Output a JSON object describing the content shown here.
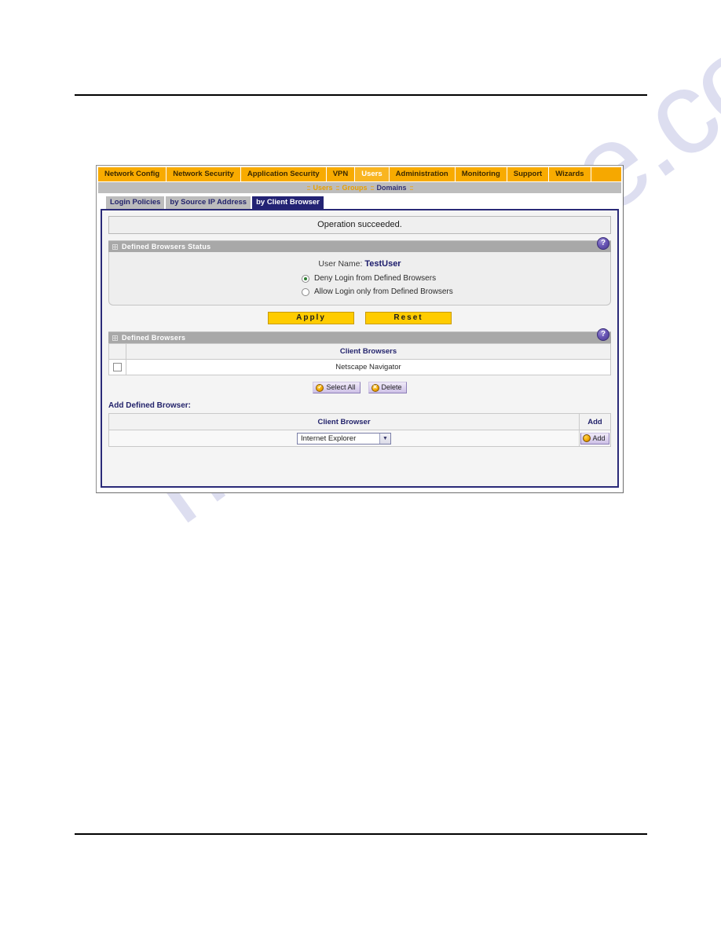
{
  "watermark": "manualslive.com",
  "topnav": {
    "items": [
      {
        "label": "Network Config",
        "active": false
      },
      {
        "label": "Network Security",
        "active": false
      },
      {
        "label": "Application Security",
        "active": false
      },
      {
        "label": "VPN",
        "active": false
      },
      {
        "label": "Users",
        "active": true
      },
      {
        "label": "Administration",
        "active": false
      },
      {
        "label": "Monitoring",
        "active": false
      },
      {
        "label": "Support",
        "active": false
      },
      {
        "label": "Wizards",
        "active": false
      }
    ]
  },
  "subnav": {
    "sep": "::",
    "items": [
      {
        "label": "Users",
        "current": false
      },
      {
        "label": "Groups",
        "current": false
      },
      {
        "label": "Domains",
        "current": true
      }
    ]
  },
  "tabs": [
    {
      "label": "Login Policies",
      "active": false
    },
    {
      "label": "by Source IP Address",
      "active": false
    },
    {
      "label": "by Client Browser",
      "active": true
    }
  ],
  "message": "Operation succeeded.",
  "status_section": {
    "title": "Defined Browsers Status",
    "help_icon": "help-question-icon",
    "help_glyph": "?",
    "user_name_label": "User Name:",
    "user_name_value": "TestUser",
    "options": [
      {
        "label": "Deny Login from Defined Browsers",
        "selected": true
      },
      {
        "label": "Allow Login only from Defined Browsers",
        "selected": false
      }
    ],
    "apply_label": "Apply",
    "reset_label": "Reset"
  },
  "browsers_section": {
    "title": "Defined Browsers",
    "help_glyph": "?",
    "column_header": "Client Browsers",
    "rows": [
      {
        "name": "Netscape Navigator",
        "checked": false
      }
    ],
    "select_all_label": "Select All",
    "select_all_icon": "check-circle-icon",
    "select_all_glyph": "✓",
    "delete_label": "Delete",
    "delete_icon": "x-circle-icon",
    "delete_glyph": "✕"
  },
  "add_section": {
    "label": "Add Defined Browser:",
    "column_header": "Client Browser",
    "add_column_header": "Add",
    "selected_browser": "Internet Explorer",
    "caret_glyph": "▼",
    "add_button_label": "Add",
    "add_button_icon": "add-circle-icon",
    "add_button_glyph": "◉"
  },
  "colors": {
    "topnav_bg": "#f8ab00",
    "active_tab_bg": "#232374",
    "frame_border": "#2a2a78",
    "gold_button": "#ffcc00",
    "help_purple": "#4a3a93",
    "radio_selected": "#2e7d32"
  }
}
